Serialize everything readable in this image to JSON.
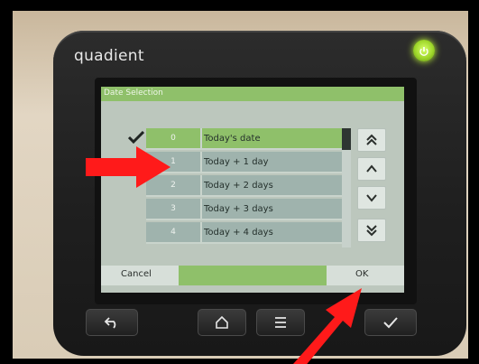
{
  "device": {
    "brand_logo": "quadient",
    "power_icon": "power-icon",
    "accent_green": "#8fc06a"
  },
  "screen": {
    "title": "Date Selection",
    "selected_check_icon": "check-icon",
    "rows": [
      {
        "index": "0",
        "label": "Today's date",
        "selected": true
      },
      {
        "index": "1",
        "label": "Today + 1 day",
        "selected": false
      },
      {
        "index": "2",
        "label": "Today + 2 days",
        "selected": false
      },
      {
        "index": "3",
        "label": "Today + 3 days",
        "selected": false
      },
      {
        "index": "4",
        "label": "Today + 4 days",
        "selected": false
      }
    ],
    "nav_buttons": [
      "double-up-chevron-icon",
      "up-chevron-icon",
      "down-chevron-icon",
      "double-down-chevron-icon"
    ],
    "cancel_label": "Cancel",
    "ok_label": "OK"
  },
  "hardware_buttons": [
    "back-icon",
    "home-icon",
    "menu-icon",
    "check-icon"
  ],
  "annotations": {
    "arrow_color": "#ff1a1a"
  }
}
